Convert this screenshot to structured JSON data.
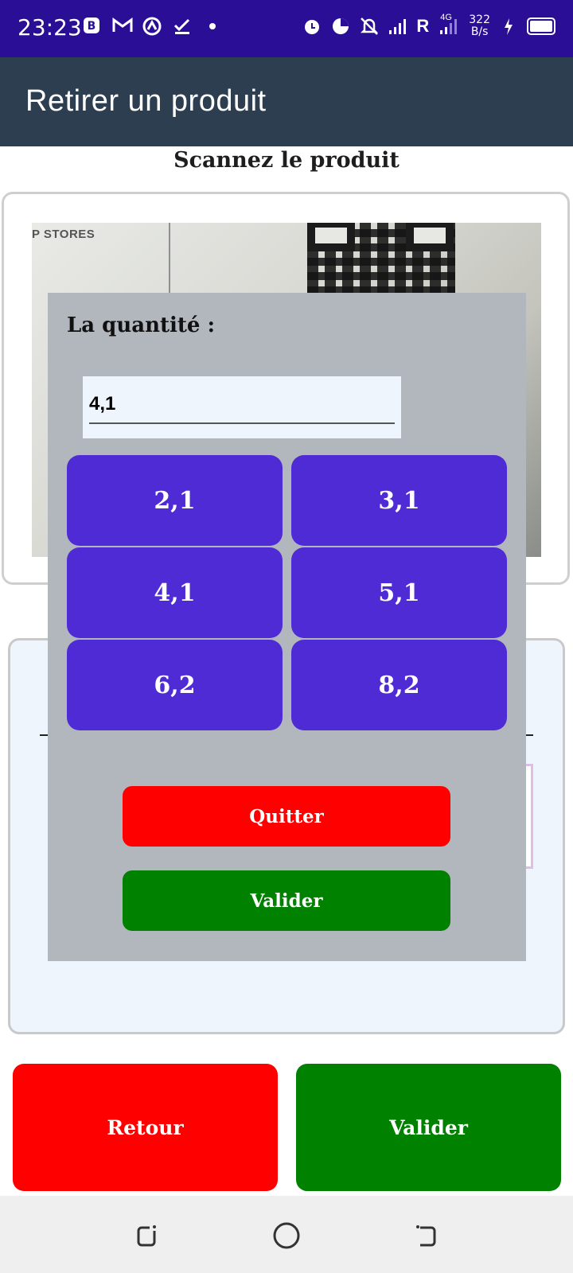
{
  "status_bar": {
    "time": "23:23",
    "network_speed_value": "322",
    "network_speed_unit": "B/s",
    "network_type": "4G",
    "roaming": "R",
    "left_icons": [
      "b-app-icon",
      "gmail-icon",
      "vpn-icon",
      "check-icon",
      "dot-icon"
    ],
    "right_icons": [
      "alarm-icon",
      "data-saver-icon",
      "mute-icon",
      "signal-icon",
      "signal-icon-2",
      "charging-icon",
      "battery-icon"
    ]
  },
  "app_bar": {
    "title": "Retirer un produit"
  },
  "scanner": {
    "title": "Scannez le produit",
    "camera_text": "P STORES"
  },
  "bottom_buttons": {
    "back_label": "Retour",
    "validate_label": "Valider"
  },
  "dialog": {
    "label": "La quantité :",
    "quantity_value": "4,1",
    "presets": [
      "2,1",
      "3,1",
      "4,1",
      "5,1",
      "6,2",
      "8,2"
    ],
    "quit_label": "Quitter",
    "validate_label": "Valider"
  },
  "colors": {
    "status_bar": "#2a0f96",
    "app_bar": "#2d3e50",
    "preset_button": "#4f2bd6",
    "danger": "#fe0000",
    "success": "#018100",
    "dialog_bg": "#b2b7be"
  },
  "nav_bar": {
    "icons": [
      "recent-apps-icon",
      "home-icon",
      "back-icon"
    ]
  }
}
